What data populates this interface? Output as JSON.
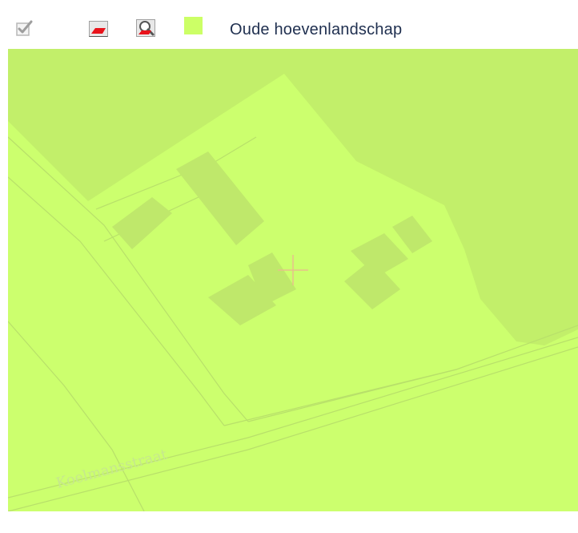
{
  "toolbar": {
    "checkbox_icon": "checkbox-checked-icon",
    "layer_icon": "layer-style-icon",
    "zoom_icon": "zoom-to-layer-icon",
    "legend_color": "#ccff66",
    "layer_label": "Oude hoevenlandschap"
  },
  "map": {
    "street_label": "Koelmansstraat",
    "colors": {
      "base": "#ccff6e",
      "darker_zone": "#c2ef6a",
      "building": "#bfe86b",
      "outline": "#b8e06a",
      "crosshair": "#e6c08a",
      "street_text": "#c6e88d"
    },
    "crosshair_icon": "crosshair-icon"
  }
}
